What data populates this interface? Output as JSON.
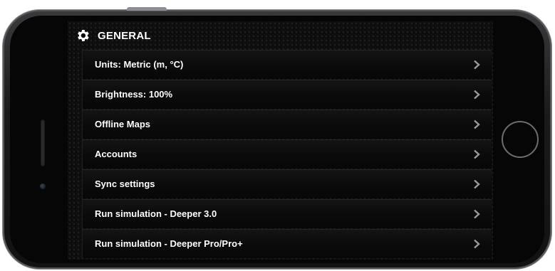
{
  "settings": {
    "section_title": "GENERAL",
    "section_icon": "gear-icon",
    "items": [
      {
        "label": "Units: Metric (m, °C)",
        "icon": "chevron-right-icon"
      },
      {
        "label": "Brightness: 100%",
        "icon": "chevron-right-icon"
      },
      {
        "label": "Offline Maps",
        "icon": "chevron-right-icon"
      },
      {
        "label": "Accounts",
        "icon": "chevron-right-icon"
      },
      {
        "label": "Sync settings",
        "icon": "chevron-right-icon"
      },
      {
        "label": "Run simulation - Deeper 3.0",
        "icon": "chevron-right-icon"
      },
      {
        "label": "Run simulation - Deeper Pro/Pro+",
        "icon": "chevron-right-icon"
      }
    ]
  },
  "colors": {
    "text": "#ffffff",
    "chevron": "#9a9a9a",
    "background": "#0c0c0c"
  }
}
